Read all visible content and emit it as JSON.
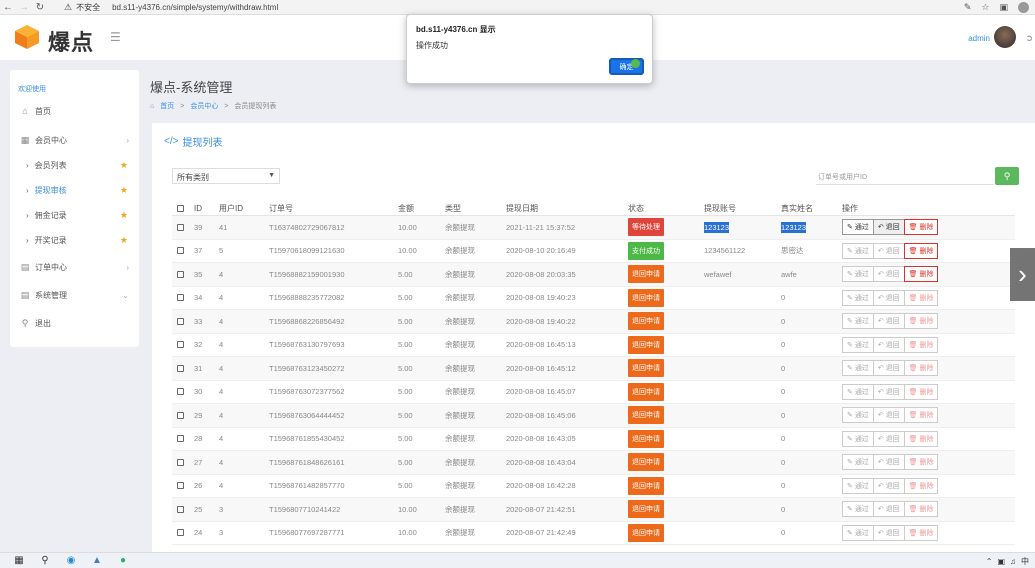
{
  "browser": {
    "warning": "⚠",
    "insecure": "不安全",
    "url": "bd.s11-y4376.cn/simple/systemy/withdraw.html"
  },
  "header": {
    "logo": "爆点",
    "admin_name": "admin"
  },
  "sidebar": {
    "title": "欢迎使用",
    "items": [
      {
        "label": "首页"
      },
      {
        "label": "会员中心"
      },
      {
        "label": "会员列表"
      },
      {
        "label": "提现审核"
      },
      {
        "label": "佣金记录"
      },
      {
        "label": "开奖记录"
      },
      {
        "label": "订单中心"
      },
      {
        "label": "系统管理"
      },
      {
        "label": "退出"
      }
    ]
  },
  "main": {
    "title": "爆点-系统管理",
    "breadcrumb": [
      "首页",
      "会员中心",
      "会员提现列表"
    ],
    "card_title": "提现列表",
    "type_select": "所有类别",
    "search_placeholder": "订单号或用户ID"
  },
  "table": {
    "headers": [
      "ID",
      "用户ID",
      "订单号",
      "金额",
      "类型",
      "提现日期",
      "状态",
      "提现账号",
      "真实姓名",
      "操作"
    ],
    "op_labels": {
      "pass": "通过",
      "return": "退回",
      "delete": "删除"
    },
    "rows": [
      {
        "id": "39",
        "uid": "41",
        "order": "T1637480272906781​2",
        "amount": "10.00",
        "type": "余额提现",
        "date": "2021-11-21 15:37:52",
        "status": "等待处理",
        "status_color": "red",
        "account": "123123",
        "name": "123123",
        "ops": "active"
      },
      {
        "id": "37",
        "uid": "5",
        "order": "T1597061809912163​0",
        "amount": "10.00",
        "type": "余额提现",
        "date": "2020-08-10 20:16:49",
        "status": "支付成功",
        "status_color": "green",
        "account": "1234561122",
        "name": "思密达",
        "ops": "delete"
      },
      {
        "id": "35",
        "uid": "4",
        "order": "T1596888215900193​0",
        "amount": "5.00",
        "type": "余额提现",
        "date": "2020-08-08 20:03:35",
        "status": "退回申请",
        "status_color": "orange",
        "account": "wefawef",
        "name": "awfe",
        "ops": "delete"
      },
      {
        "id": "34",
        "uid": "4",
        "order": "T1596888823577208​2",
        "amount": "5.00",
        "type": "余额提现",
        "date": "2020-08-08 19:40:23",
        "status": "退回申请",
        "status_color": "orange",
        "account": "",
        "name": "0",
        "ops": "none"
      },
      {
        "id": "33",
        "uid": "4",
        "order": "T1596886822685649​2",
        "amount": "5.00",
        "type": "余额提现",
        "date": "2020-08-08 19:40:22",
        "status": "退回申请",
        "status_color": "orange",
        "account": "",
        "name": "0",
        "ops": "none"
      },
      {
        "id": "32",
        "uid": "4",
        "order": "T1596876313079769​3",
        "amount": "5.00",
        "type": "余额提现",
        "date": "2020-08-08 16:45:13",
        "status": "退回申请",
        "status_color": "orange",
        "account": "",
        "name": "0",
        "ops": "none"
      },
      {
        "id": "31",
        "uid": "4",
        "order": "T1596876312345027​2",
        "amount": "5.00",
        "type": "余额提现",
        "date": "2020-08-08 16:45:12",
        "status": "退回申请",
        "status_color": "orange",
        "account": "",
        "name": "0",
        "ops": "none"
      },
      {
        "id": "30",
        "uid": "4",
        "order": "T1596876307237756​2",
        "amount": "5.00",
        "type": "余额提现",
        "date": "2020-08-08 16:45:07",
        "status": "退回申请",
        "status_color": "orange",
        "account": "",
        "name": "0",
        "ops": "none"
      },
      {
        "id": "29",
        "uid": "4",
        "order": "T1596876306444445​2",
        "amount": "5.00",
        "type": "余额提现",
        "date": "2020-08-08 16:45:06",
        "status": "退回申请",
        "status_color": "orange",
        "account": "",
        "name": "0",
        "ops": "none"
      },
      {
        "id": "28",
        "uid": "4",
        "order": "T1596876185543045​2",
        "amount": "5.00",
        "type": "余额提现",
        "date": "2020-08-08 16:43:05",
        "status": "退回申请",
        "status_color": "orange",
        "account": "",
        "name": "0",
        "ops": "none"
      },
      {
        "id": "27",
        "uid": "4",
        "order": "T1596876184862616​1",
        "amount": "5.00",
        "type": "余额提现",
        "date": "2020-08-08 16:43:04",
        "status": "退回申请",
        "status_color": "orange",
        "account": "",
        "name": "0",
        "ops": "none"
      },
      {
        "id": "26",
        "uid": "4",
        "order": "T1596876148285777​0",
        "amount": "5.00",
        "type": "余额提现",
        "date": "2020-08-08 16:42:28",
        "status": "退回申请",
        "status_color": "orange",
        "account": "",
        "name": "0",
        "ops": "none"
      },
      {
        "id": "25",
        "uid": "3",
        "order": "T1596807710241422",
        "amount": "10.00",
        "type": "余额提现",
        "date": "2020-08-07 21:42:51",
        "status": "退回申请",
        "status_color": "orange",
        "account": "",
        "name": "0",
        "ops": "none"
      },
      {
        "id": "24",
        "uid": "3",
        "order": "T1596807769728777​1",
        "amount": "10.00",
        "type": "余额提现",
        "date": "2020-08-07 21:42:49",
        "status": "退回申请",
        "status_color": "orange",
        "account": "",
        "name": "0",
        "ops": "none"
      }
    ]
  },
  "dialog": {
    "title": "bd.s11-y4376.cn 显示",
    "message": "操作成功",
    "ok_label": "确定"
  },
  "colors": {
    "accent": "#3a8ee6",
    "red": "#e0453b",
    "green": "#4cb845",
    "orange": "#ee6a1a",
    "search_btn": "#5cb85c"
  }
}
